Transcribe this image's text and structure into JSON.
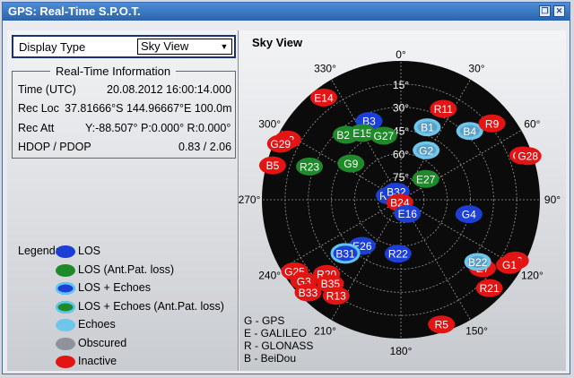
{
  "window": {
    "title": "GPS: Real-Time S.P.O.T.",
    "restore_glyph": "❐",
    "close_glyph": "✕"
  },
  "display_type": {
    "label": "Display Type",
    "value": "Sky View"
  },
  "realtime": {
    "heading": "Real-Time Information",
    "rows": [
      {
        "label": "Time (UTC)",
        "value": "20.08.2012 16:00:14.000"
      },
      {
        "label": "Rec Loc",
        "value": "37.81666°S 144.96667°E 100.0m"
      },
      {
        "label": "Rec Att",
        "value": "Y:-88.507° P:0.000° R:0.000°"
      },
      {
        "label": "HDOP / PDOP",
        "value": "0.83 / 2.06"
      }
    ]
  },
  "legend": {
    "title": "Legend:",
    "items": [
      {
        "label": "LOS",
        "fill": "#1c3fd6",
        "ring": ""
      },
      {
        "label": "LOS (Ant.Pat. loss)",
        "fill": "#1f8a2a",
        "ring": ""
      },
      {
        "label": "LOS + Echoes",
        "fill": "#1c3fd6",
        "ring": "#5fc8f2"
      },
      {
        "label": "LOS + Echoes (Ant.Pat. loss)",
        "fill": "#1f8a2a",
        "ring": "#5fc8f2"
      },
      {
        "label": "Echoes",
        "fill": "#6fc6ea",
        "ring": ""
      },
      {
        "label": "Obscured",
        "fill": "#8f9399",
        "ring": ""
      },
      {
        "label": "Inactive",
        "fill": "#e31414",
        "ring": ""
      }
    ]
  },
  "sky_view": {
    "title": "Sky View",
    "elevation_labels": [
      "0°",
      "15°",
      "30°",
      "45°",
      "60°",
      "75°"
    ],
    "azimuth_labels": [
      "0°",
      "30°",
      "60°",
      "90°",
      "120°",
      "150°",
      "180°",
      "210°",
      "240°",
      "270°",
      "300°",
      "330°"
    ],
    "systems": [
      "G - GPS",
      "E - GALILEO",
      "R - GLONASS",
      "B - BeiDou"
    ],
    "colors": {
      "los": "#1c3fd6",
      "ant_loss": "#1f8a2a",
      "echoes": "#6fc6ea",
      "echo_ring": "#5fc8f2",
      "inactive": "#e31414",
      "sky": "#0b0b0b",
      "grid": "#9a9a9a"
    },
    "satellites": [
      {
        "id": "R11",
        "az": 25,
        "el": 25,
        "state": "inactive"
      },
      {
        "id": "E14",
        "az": 323,
        "el": 7,
        "state": "inactive"
      },
      {
        "id": "B3",
        "az": 338,
        "el": 35,
        "state": "los"
      },
      {
        "id": "B1",
        "az": 20,
        "el": 40,
        "state": "echoes"
      },
      {
        "id": "B4",
        "az": 45,
        "el": 27,
        "state": "echoes"
      },
      {
        "id": "R9",
        "az": 50,
        "el": 13,
        "state": "inactive"
      },
      {
        "id": "B20",
        "az": 320,
        "el": 35,
        "state": "ant_loss"
      },
      {
        "id": "E15",
        "az": 330,
        "el": 40,
        "state": "ant_loss"
      },
      {
        "id": "G27",
        "az": 345,
        "el": 47,
        "state": "ant_loss"
      },
      {
        "id": "G2",
        "az": 27,
        "el": 54,
        "state": "echoes"
      },
      {
        "id": "G10",
        "az": 70,
        "el": 6,
        "state": "inactive"
      },
      {
        "id": "G28",
        "az": 71,
        "el": 3,
        "state": "inactive"
      },
      {
        "id": "B2",
        "az": 298,
        "el": 7,
        "state": "inactive"
      },
      {
        "id": "G29",
        "az": 295,
        "el": 4,
        "state": "inactive"
      },
      {
        "id": "G9",
        "az": 306,
        "el": 50,
        "state": "ant_loss"
      },
      {
        "id": "E27",
        "az": 50,
        "el": 69,
        "state": "ant_loss"
      },
      {
        "id": "B5",
        "az": 285,
        "el": 4,
        "state": "inactive"
      },
      {
        "id": "R23",
        "az": 290,
        "el": 27,
        "state": "ant_loss"
      },
      {
        "id": "R12",
        "az": 290,
        "el": 82,
        "state": "los"
      },
      {
        "id": "B32",
        "az": 330,
        "el": 84,
        "state": "los"
      },
      {
        "id": "B24",
        "az": 200,
        "el": 88,
        "state": "inactive"
      },
      {
        "id": "E16",
        "az": 155,
        "el": 80,
        "state": "los"
      },
      {
        "id": "G4",
        "az": 102,
        "el": 45,
        "state": "los"
      },
      {
        "id": "E26",
        "az": 220,
        "el": 51,
        "state": "los"
      },
      {
        "id": "R22",
        "az": 183,
        "el": 55,
        "state": "los"
      },
      {
        "id": "B31",
        "az": 226,
        "el": 40,
        "state": "los_echo"
      },
      {
        "id": "G25",
        "az": 236,
        "el": 7,
        "state": "inactive"
      },
      {
        "id": "R20",
        "az": 225,
        "el": 22,
        "state": "inactive"
      },
      {
        "id": "B35",
        "az": 220,
        "el": 19,
        "state": "inactive"
      },
      {
        "id": "G3",
        "az": 230,
        "el": 8,
        "state": "inactive"
      },
      {
        "id": "B33",
        "az": 225,
        "el": 5,
        "state": "inactive"
      },
      {
        "id": "R13",
        "az": 214,
        "el": 15,
        "state": "inactive"
      },
      {
        "id": "R6",
        "az": 118,
        "el": 6,
        "state": "inactive"
      },
      {
        "id": "G1",
        "az": 121,
        "el": 8,
        "state": "inactive"
      },
      {
        "id": "E7",
        "az": 130,
        "el": 21,
        "state": "inactive"
      },
      {
        "id": "B22",
        "az": 129,
        "el": 26,
        "state": "echoes"
      },
      {
        "id": "R21",
        "az": 135,
        "el": 9,
        "state": "inactive"
      },
      {
        "id": "R5",
        "az": 162,
        "el": 5,
        "state": "inactive"
      }
    ]
  }
}
